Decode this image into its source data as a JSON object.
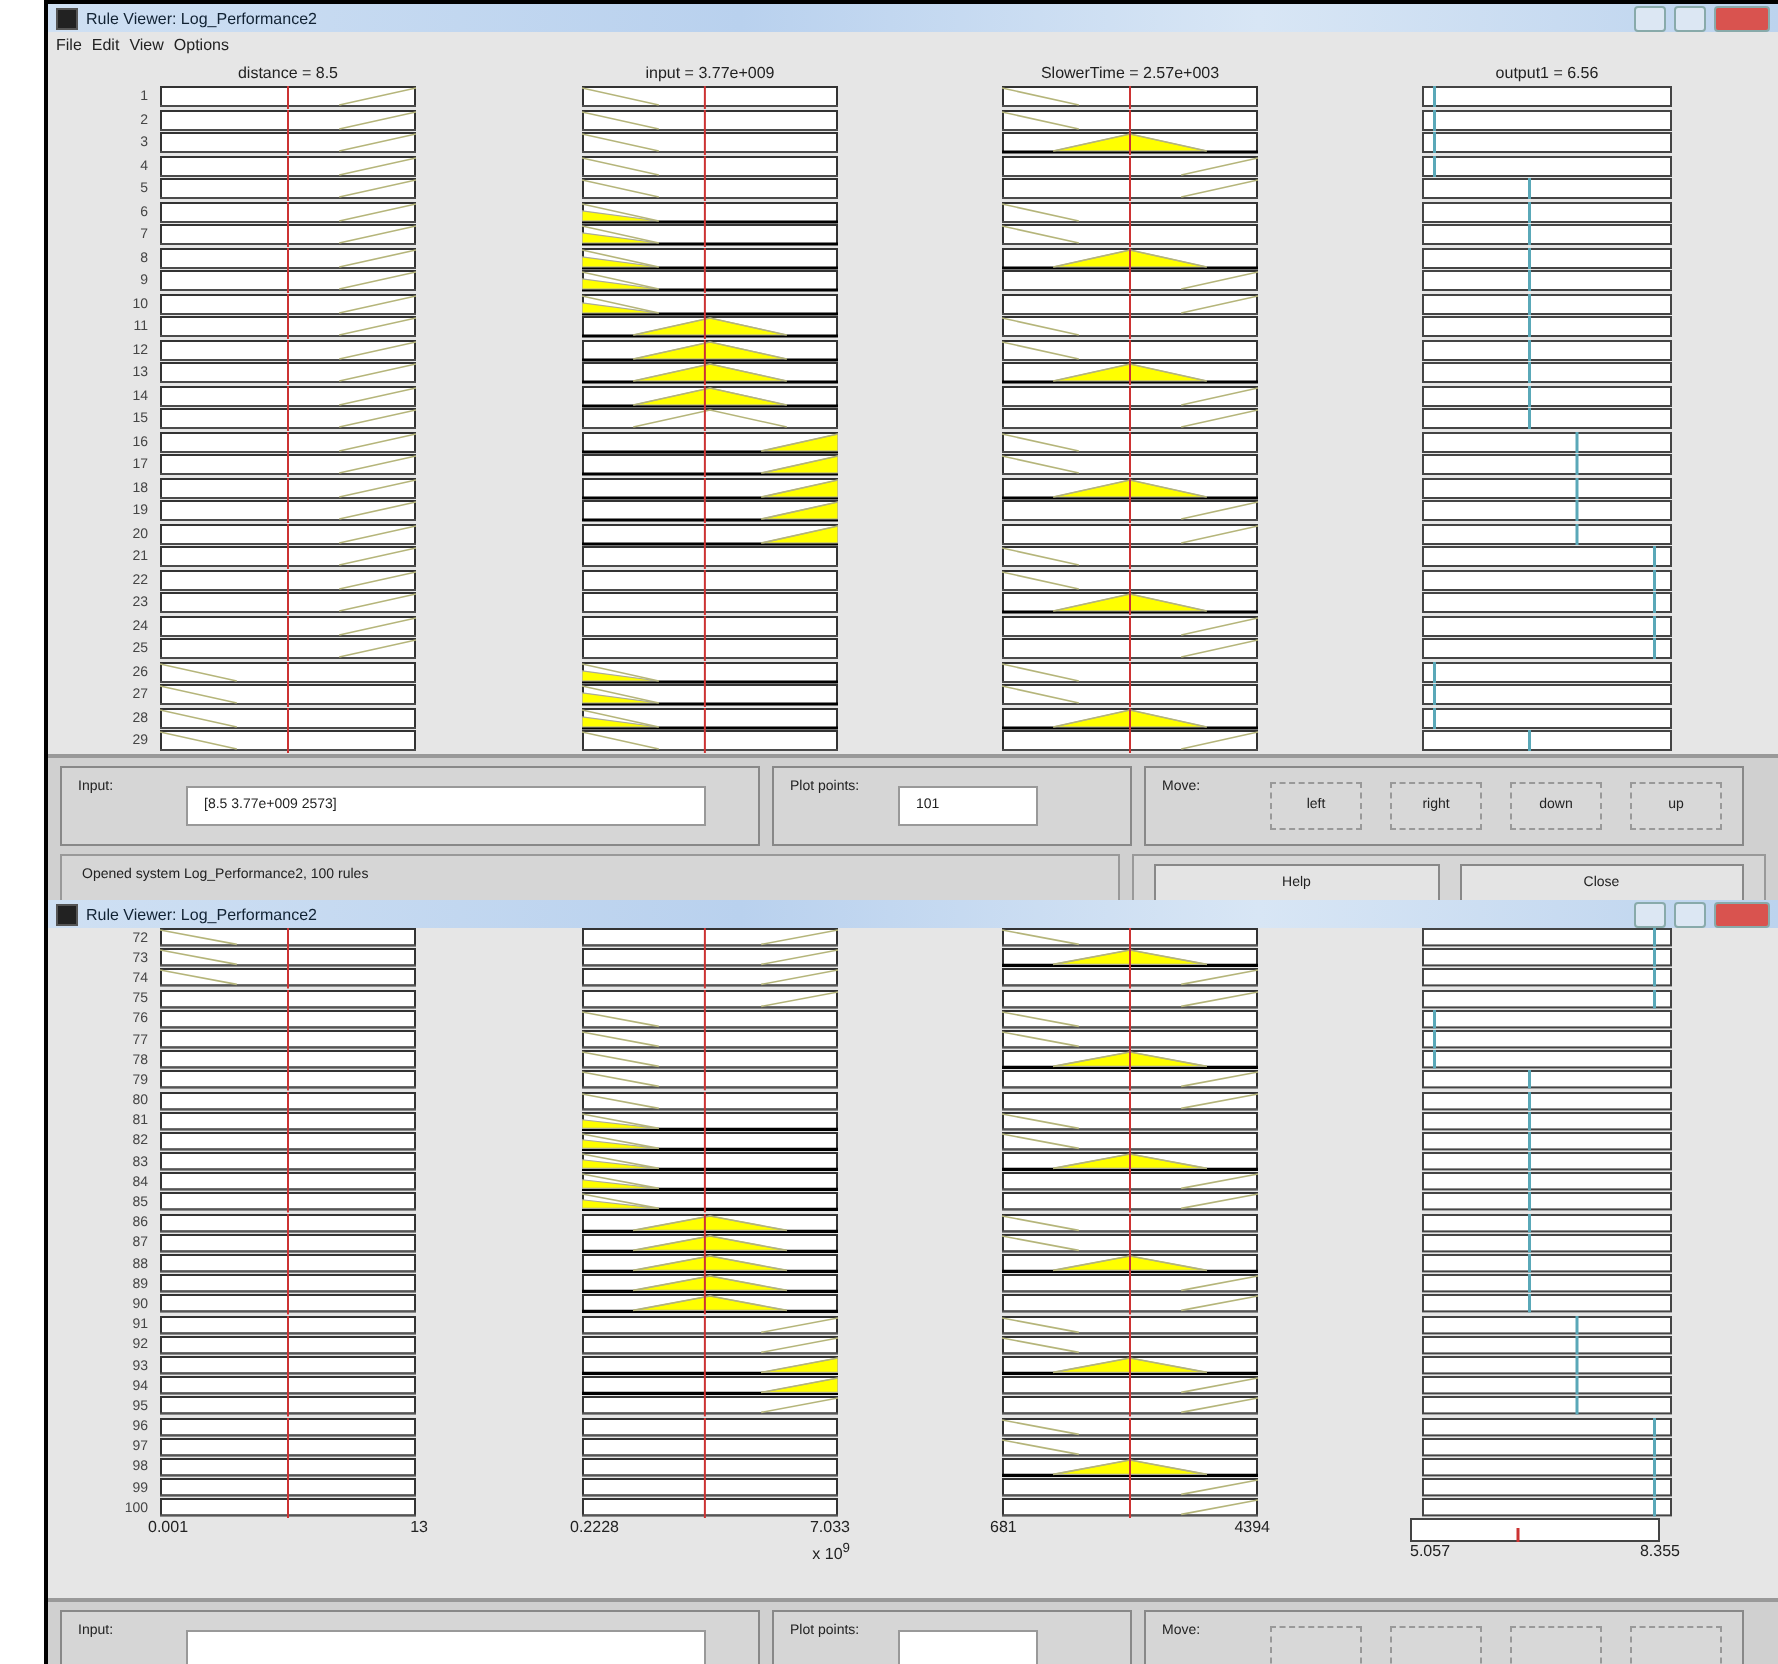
{
  "windows": [
    {
      "title": "Rule Viewer: Log_Performance2",
      "menu": [
        "File",
        "Edit",
        "View",
        "Options"
      ],
      "headers": [
        "distance = 8.5",
        "input = 3.77e+009",
        "SlowerTime = 2.57e+003",
        "output1 = 6.56"
      ],
      "rows": [
        {
          "rule": "1",
          "cells": [
            {
              "kind": "high",
              "fired": false
            },
            {
              "kind": "low",
              "fired": false
            },
            {
              "kind": "low",
              "fired": false
            }
          ],
          "output": {
            "kind": "mf1"
          }
        },
        {
          "rule": "2",
          "cells": [
            {
              "kind": "high",
              "fired": false
            },
            {
              "kind": "low",
              "fired": false
            },
            {
              "kind": "low",
              "fired": false
            }
          ],
          "output": {
            "kind": "mf1"
          }
        },
        {
          "rule": "3",
          "cells": [
            {
              "kind": "high",
              "fired": false
            },
            {
              "kind": "low",
              "fired": false
            },
            {
              "kind": "mid",
              "fired": true
            }
          ],
          "output": {
            "kind": "mf1"
          }
        },
        {
          "rule": "4",
          "cells": [
            {
              "kind": "high",
              "fired": false
            },
            {
              "kind": "low",
              "fired": false
            },
            {
              "kind": "high",
              "fired": false
            }
          ],
          "output": {
            "kind": "mf1"
          }
        },
        {
          "rule": "5",
          "cells": [
            {
              "kind": "high",
              "fired": false
            },
            {
              "kind": "low",
              "fired": false
            },
            {
              "kind": "high",
              "fired": false
            }
          ],
          "output": {
            "kind": "mf2"
          }
        },
        {
          "rule": "6",
          "cells": [
            {
              "kind": "high",
              "fired": false
            },
            {
              "kind": "low",
              "fired": true
            },
            {
              "kind": "low",
              "fired": false
            }
          ],
          "output": {
            "kind": "mf2"
          }
        },
        {
          "rule": "7",
          "cells": [
            {
              "kind": "high",
              "fired": false
            },
            {
              "kind": "low",
              "fired": true
            },
            {
              "kind": "low",
              "fired": false
            }
          ],
          "output": {
            "kind": "mf2"
          }
        },
        {
          "rule": "8",
          "cells": [
            {
              "kind": "high",
              "fired": false
            },
            {
              "kind": "low",
              "fired": true
            },
            {
              "kind": "mid",
              "fired": true
            }
          ],
          "output": {
            "kind": "mf2"
          }
        },
        {
          "rule": "9",
          "cells": [
            {
              "kind": "high",
              "fired": false
            },
            {
              "kind": "low",
              "fired": true
            },
            {
              "kind": "high",
              "fired": false
            }
          ],
          "output": {
            "kind": "mf2"
          }
        },
        {
          "rule": "10",
          "cells": [
            {
              "kind": "high",
              "fired": false
            },
            {
              "kind": "low",
              "fired": true
            },
            {
              "kind": "high",
              "fired": false
            }
          ],
          "output": {
            "kind": "mf2"
          }
        },
        {
          "rule": "11",
          "cells": [
            {
              "kind": "high",
              "fired": false
            },
            {
              "kind": "mid",
              "fired": true
            },
            {
              "kind": "low",
              "fired": false
            }
          ],
          "output": {
            "kind": "mf2"
          }
        },
        {
          "rule": "12",
          "cells": [
            {
              "kind": "high",
              "fired": false
            },
            {
              "kind": "mid",
              "fired": true
            },
            {
              "kind": "low",
              "fired": false
            }
          ],
          "output": {
            "kind": "mf2"
          }
        },
        {
          "rule": "13",
          "cells": [
            {
              "kind": "high",
              "fired": false
            },
            {
              "kind": "mid",
              "fired": true
            },
            {
              "kind": "mid",
              "fired": true
            }
          ],
          "output": {
            "kind": "mf2"
          }
        },
        {
          "rule": "14",
          "cells": [
            {
              "kind": "high",
              "fired": false
            },
            {
              "kind": "mid",
              "fired": true
            },
            {
              "kind": "high",
              "fired": false
            }
          ],
          "output": {
            "kind": "mf2"
          }
        },
        {
          "rule": "15",
          "cells": [
            {
              "kind": "high",
              "fired": false
            },
            {
              "kind": "mid",
              "fired": false
            },
            {
              "kind": "high",
              "fired": false
            }
          ],
          "output": {
            "kind": "mf2"
          }
        },
        {
          "rule": "16",
          "cells": [
            {
              "kind": "high",
              "fired": false
            },
            {
              "kind": "high",
              "fired": true
            },
            {
              "kind": "low",
              "fired": false
            }
          ],
          "output": {
            "kind": "mf3"
          }
        },
        {
          "rule": "17",
          "cells": [
            {
              "kind": "high",
              "fired": false
            },
            {
              "kind": "high",
              "fired": true
            },
            {
              "kind": "low",
              "fired": false
            }
          ],
          "output": {
            "kind": "mf3"
          }
        },
        {
          "rule": "18",
          "cells": [
            {
              "kind": "high",
              "fired": false
            },
            {
              "kind": "high",
              "fired": true
            },
            {
              "kind": "mid",
              "fired": true
            }
          ],
          "output": {
            "kind": "mf3"
          }
        },
        {
          "rule": "19",
          "cells": [
            {
              "kind": "high",
              "fired": false
            },
            {
              "kind": "high",
              "fired": true
            },
            {
              "kind": "high",
              "fired": false
            }
          ],
          "output": {
            "kind": "mf3"
          }
        },
        {
          "rule": "20",
          "cells": [
            {
              "kind": "high",
              "fired": false
            },
            {
              "kind": "high",
              "fired": true
            },
            {
              "kind": "high",
              "fired": false
            }
          ],
          "output": {
            "kind": "mf3"
          }
        },
        {
          "rule": "21",
          "cells": [
            {
              "kind": "high",
              "fired": false
            },
            {
              "kind": "none",
              "fired": false
            },
            {
              "kind": "low",
              "fired": false
            }
          ],
          "output": {
            "kind": "mf4"
          }
        },
        {
          "rule": "22",
          "cells": [
            {
              "kind": "high",
              "fired": false
            },
            {
              "kind": "none",
              "fired": false
            },
            {
              "kind": "low",
              "fired": false
            }
          ],
          "output": {
            "kind": "mf4"
          }
        },
        {
          "rule": "23",
          "cells": [
            {
              "kind": "high",
              "fired": false
            },
            {
              "kind": "none",
              "fired": false
            },
            {
              "kind": "mid",
              "fired": true
            }
          ],
          "output": {
            "kind": "mf4"
          }
        },
        {
          "rule": "24",
          "cells": [
            {
              "kind": "high",
              "fired": false
            },
            {
              "kind": "none",
              "fired": false
            },
            {
              "kind": "high",
              "fired": false
            }
          ],
          "output": {
            "kind": "mf4"
          }
        },
        {
          "rule": "25",
          "cells": [
            {
              "kind": "high",
              "fired": false
            },
            {
              "kind": "none",
              "fired": false
            },
            {
              "kind": "high",
              "fired": false
            }
          ],
          "output": {
            "kind": "mf4"
          }
        },
        {
          "rule": "26",
          "cells": [
            {
              "kind": "low",
              "fired": false
            },
            {
              "kind": "low",
              "fired": true
            },
            {
              "kind": "low",
              "fired": false
            }
          ],
          "output": {
            "kind": "mf1"
          }
        },
        {
          "rule": "27",
          "cells": [
            {
              "kind": "low",
              "fired": false
            },
            {
              "kind": "low",
              "fired": true
            },
            {
              "kind": "low",
              "fired": false
            }
          ],
          "output": {
            "kind": "mf1"
          }
        },
        {
          "rule": "28",
          "cells": [
            {
              "kind": "low",
              "fired": false
            },
            {
              "kind": "low",
              "fired": true
            },
            {
              "kind": "mid",
              "fired": true
            }
          ],
          "output": {
            "kind": "mf1"
          }
        },
        {
          "rule": "29",
          "cells": [
            {
              "kind": "low",
              "fired": false
            },
            {
              "kind": "low",
              "fired": false
            },
            {
              "kind": "high",
              "fired": false
            }
          ],
          "output": {
            "kind": "mf2"
          }
        }
      ],
      "panel": {
        "input_label": "Input:",
        "input_value": "[8.5 3.77e+009 2573]",
        "points_label": "Plot points:",
        "points_value": "101",
        "move_label": "Move:",
        "move_buttons": [
          {
            "kind": "button",
            "label": "left"
          },
          {
            "kind": "button",
            "label": "right"
          },
          {
            "kind": "button",
            "label": "down"
          },
          {
            "kind": "button",
            "label": "up"
          }
        ],
        "status": "Opened system Log_Performance2, 100 rules",
        "buttons": [
          "Help",
          "Close"
        ]
      }
    },
    {
      "title": "Rule Viewer: Log_Performance2",
      "rows": [
        {
          "rule": "72",
          "cells": [
            {
              "kind": "low",
              "fired": false
            },
            {
              "kind": "high",
              "fired": false
            },
            {
              "kind": "low",
              "fired": false
            }
          ],
          "output": {
            "kind": "mf4"
          }
        },
        {
          "rule": "73",
          "cells": [
            {
              "kind": "low",
              "fired": false
            },
            {
              "kind": "high",
              "fired": false
            },
            {
              "kind": "mid",
              "fired": true
            }
          ],
          "output": {
            "kind": "mf4"
          }
        },
        {
          "rule": "74",
          "cells": [
            {
              "kind": "low",
              "fired": false
            },
            {
              "kind": "high",
              "fired": false
            },
            {
              "kind": "high",
              "fired": false
            }
          ],
          "output": {
            "kind": "mf4"
          }
        },
        {
          "rule": "75",
          "cells": [
            {
              "kind": "none",
              "fired": false
            },
            {
              "kind": "high",
              "fired": false
            },
            {
              "kind": "high",
              "fired": false
            }
          ],
          "output": {
            "kind": "mf4"
          }
        },
        {
          "rule": "76",
          "cells": [
            {
              "kind": "none",
              "fired": false
            },
            {
              "kind": "low",
              "fired": false
            },
            {
              "kind": "low",
              "fired": false
            }
          ],
          "output": {
            "kind": "mf1"
          }
        },
        {
          "rule": "77",
          "cells": [
            {
              "kind": "none",
              "fired": false
            },
            {
              "kind": "low",
              "fired": false
            },
            {
              "kind": "low",
              "fired": false
            }
          ],
          "output": {
            "kind": "mf1"
          }
        },
        {
          "rule": "78",
          "cells": [
            {
              "kind": "none",
              "fired": false
            },
            {
              "kind": "low",
              "fired": false
            },
            {
              "kind": "mid",
              "fired": true
            }
          ],
          "output": {
            "kind": "mf1"
          }
        },
        {
          "rule": "79",
          "cells": [
            {
              "kind": "none",
              "fired": false
            },
            {
              "kind": "low",
              "fired": false
            },
            {
              "kind": "high",
              "fired": false
            }
          ],
          "output": {
            "kind": "mf2"
          }
        },
        {
          "rule": "80",
          "cells": [
            {
              "kind": "none",
              "fired": false
            },
            {
              "kind": "low",
              "fired": false
            },
            {
              "kind": "high",
              "fired": false
            }
          ],
          "output": {
            "kind": "mf2"
          }
        },
        {
          "rule": "81",
          "cells": [
            {
              "kind": "none",
              "fired": false
            },
            {
              "kind": "low",
              "fired": true
            },
            {
              "kind": "low",
              "fired": false
            }
          ],
          "output": {
            "kind": "mf2"
          }
        },
        {
          "rule": "82",
          "cells": [
            {
              "kind": "none",
              "fired": false
            },
            {
              "kind": "low",
              "fired": true
            },
            {
              "kind": "low",
              "fired": false
            }
          ],
          "output": {
            "kind": "mf2"
          }
        },
        {
          "rule": "83",
          "cells": [
            {
              "kind": "none",
              "fired": false
            },
            {
              "kind": "low",
              "fired": true
            },
            {
              "kind": "mid",
              "fired": true
            }
          ],
          "output": {
            "kind": "mf2"
          }
        },
        {
          "rule": "84",
          "cells": [
            {
              "kind": "none",
              "fired": false
            },
            {
              "kind": "low",
              "fired": true
            },
            {
              "kind": "high",
              "fired": false
            }
          ],
          "output": {
            "kind": "mf2"
          }
        },
        {
          "rule": "85",
          "cells": [
            {
              "kind": "none",
              "fired": false
            },
            {
              "kind": "low",
              "fired": true
            },
            {
              "kind": "high",
              "fired": false
            }
          ],
          "output": {
            "kind": "mf2"
          }
        },
        {
          "rule": "86",
          "cells": [
            {
              "kind": "none",
              "fired": false
            },
            {
              "kind": "mid",
              "fired": true
            },
            {
              "kind": "low",
              "fired": false
            }
          ],
          "output": {
            "kind": "mf2"
          }
        },
        {
          "rule": "87",
          "cells": [
            {
              "kind": "none",
              "fired": false
            },
            {
              "kind": "mid",
              "fired": true
            },
            {
              "kind": "low",
              "fired": false
            }
          ],
          "output": {
            "kind": "mf2"
          }
        },
        {
          "rule": "88",
          "cells": [
            {
              "kind": "none",
              "fired": false
            },
            {
              "kind": "mid",
              "fired": true
            },
            {
              "kind": "mid",
              "fired": true
            }
          ],
          "output": {
            "kind": "mf2"
          }
        },
        {
          "rule": "89",
          "cells": [
            {
              "kind": "none",
              "fired": false
            },
            {
              "kind": "mid",
              "fired": true
            },
            {
              "kind": "high",
              "fired": false
            }
          ],
          "output": {
            "kind": "mf2"
          }
        },
        {
          "rule": "90",
          "cells": [
            {
              "kind": "none",
              "fired": false
            },
            {
              "kind": "mid",
              "fired": true
            },
            {
              "kind": "high",
              "fired": false
            }
          ],
          "output": {
            "kind": "mf2"
          }
        },
        {
          "rule": "91",
          "cells": [
            {
              "kind": "none",
              "fired": false
            },
            {
              "kind": "high",
              "fired": false
            },
            {
              "kind": "low",
              "fired": false
            }
          ],
          "output": {
            "kind": "mf3"
          }
        },
        {
          "rule": "92",
          "cells": [
            {
              "kind": "none",
              "fired": false
            },
            {
              "kind": "high",
              "fired": false
            },
            {
              "kind": "low",
              "fired": false
            }
          ],
          "output": {
            "kind": "mf3"
          }
        },
        {
          "rule": "93",
          "cells": [
            {
              "kind": "none",
              "fired": false
            },
            {
              "kind": "high",
              "fired": true
            },
            {
              "kind": "mid",
              "fired": true
            }
          ],
          "output": {
            "kind": "mf3"
          }
        },
        {
          "rule": "94",
          "cells": [
            {
              "kind": "none",
              "fired": false
            },
            {
              "kind": "high",
              "fired": true
            },
            {
              "kind": "high",
              "fired": false
            }
          ],
          "output": {
            "kind": "mf3"
          }
        },
        {
          "rule": "95",
          "cells": [
            {
              "kind": "none",
              "fired": false
            },
            {
              "kind": "high",
              "fired": false
            },
            {
              "kind": "high",
              "fired": false
            }
          ],
          "output": {
            "kind": "mf3"
          }
        },
        {
          "rule": "96",
          "cells": [
            {
              "kind": "none",
              "fired": false
            },
            {
              "kind": "none",
              "fired": false
            },
            {
              "kind": "low",
              "fired": false
            }
          ],
          "output": {
            "kind": "mf4"
          }
        },
        {
          "rule": "97",
          "cells": [
            {
              "kind": "none",
              "fired": false
            },
            {
              "kind": "none",
              "fired": false
            },
            {
              "kind": "low",
              "fired": false
            }
          ],
          "output": {
            "kind": "mf4"
          }
        },
        {
          "rule": "98",
          "cells": [
            {
              "kind": "none",
              "fired": false
            },
            {
              "kind": "none",
              "fired": false
            },
            {
              "kind": "mid",
              "fired": true
            }
          ],
          "output": {
            "kind": "mf4"
          }
        },
        {
          "rule": "99",
          "cells": [
            {
              "kind": "none",
              "fired": false
            },
            {
              "kind": "none",
              "fired": false
            },
            {
              "kind": "high",
              "fired": false
            }
          ],
          "output": {
            "kind": "mf4"
          }
        },
        {
          "rule": "100",
          "cells": [
            {
              "kind": "none",
              "fired": false
            },
            {
              "kind": "none",
              "fired": false
            },
            {
              "kind": "high",
              "fired": false
            }
          ],
          "output": {
            "kind": "mf4"
          }
        }
      ],
      "axes": [
        {
          "min": "0.001",
          "max": "13"
        },
        {
          "min": "0.2228",
          "max": "7.033",
          "scale": "x 10$^{9}$"
        },
        {
          "min": "681",
          "max": "4394"
        },
        {
          "min": "5.057",
          "max": "8.355"
        }
      ],
      "panel": {
        "input_label": "Input:",
        "points_label": "Plot points:",
        "move_label": "Move:",
        "move_buttons": [
          {
            "kind": "button"
          },
          {
            "kind": "button"
          },
          {
            "kind": "button"
          },
          {
            "kind": "button"
          }
        ]
      }
    }
  ]
}
